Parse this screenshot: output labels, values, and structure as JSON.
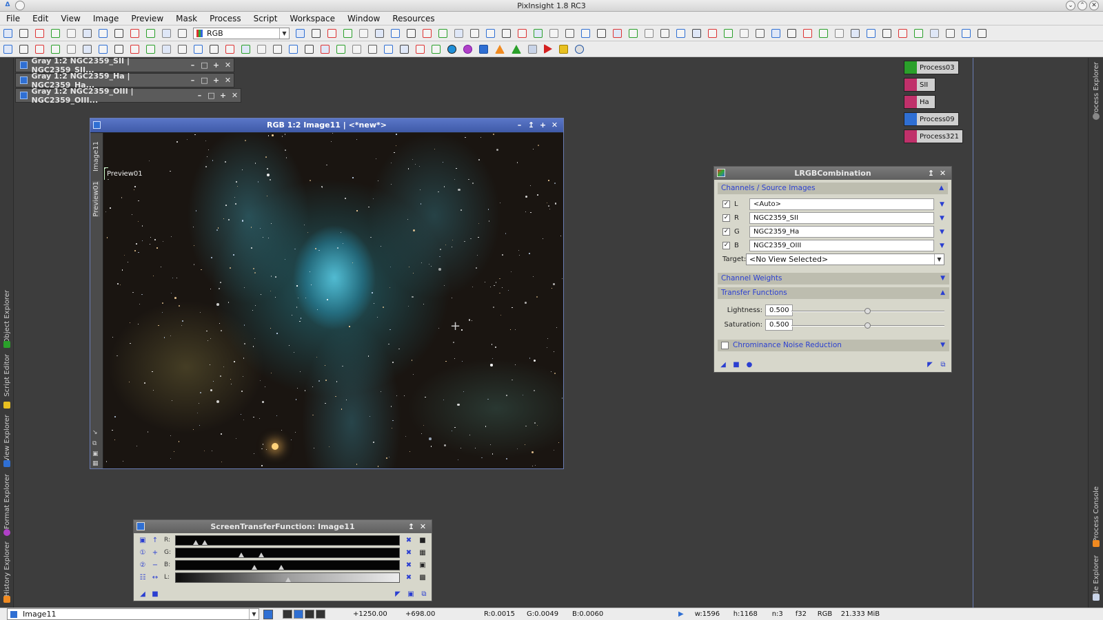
{
  "window": {
    "title": "PixInsight 1.8 RC3"
  },
  "menu": [
    "File",
    "Edit",
    "View",
    "Image",
    "Preview",
    "Mask",
    "Process",
    "Script",
    "Workspace",
    "Window",
    "Resources"
  ],
  "toolbar": {
    "channel_select": "RGB"
  },
  "left_dock_tabs": [
    {
      "label": "Object Explorer",
      "color": "#2aa02a"
    },
    {
      "label": "Script Editor",
      "color": "#e8c020"
    },
    {
      "label": "View Explorer",
      "color": "#2f6fd3"
    },
    {
      "label": "Format Explorer",
      "color": "#b040c8"
    },
    {
      "label": "History Explorer",
      "color": "#f08a20"
    }
  ],
  "right_dock_tabs": [
    {
      "label": "Process Explorer"
    },
    {
      "label": "Process Console"
    },
    {
      "label": "File Explorer"
    }
  ],
  "iconized_windows": [
    {
      "label": "Gray 1:2 NGC2359_SII | NGC2359_SII..."
    },
    {
      "label": "Gray 1:2 NGC2359_Ha | NGC2359_Ha..."
    },
    {
      "label": "Gray 1:2 NGC2359_OIII | NGC2359_OIII..."
    }
  ],
  "image_window": {
    "title": "RGB 1:2 Image11 | <*new*>",
    "side_tabs": [
      "Image11",
      "Preview01"
    ],
    "preview_label": "Preview01"
  },
  "process_icons": [
    {
      "label": "Process03",
      "color": "#2aa02a"
    },
    {
      "label": "SII",
      "color": "#c0306a"
    },
    {
      "label": "Ha",
      "color": "#c0306a"
    },
    {
      "label": "Process09",
      "color": "#2f6fd3"
    },
    {
      "label": "Process321",
      "color": "#c0306a"
    }
  ],
  "lrgb": {
    "title": "LRGBCombination",
    "section_channels": "Channels / Source Images",
    "channels": [
      {
        "letter": "L",
        "checked": true,
        "value": "<Auto>"
      },
      {
        "letter": "R",
        "checked": true,
        "value": "NGC2359_SII"
      },
      {
        "letter": "G",
        "checked": true,
        "value": "NGC2359_Ha"
      },
      {
        "letter": "B",
        "checked": true,
        "value": "NGC2359_OIII"
      }
    ],
    "target_label": "Target:",
    "target_value": "<No View Selected>",
    "section_weights": "Channel Weights",
    "section_transfer": "Transfer Functions",
    "lightness_label": "Lightness:",
    "lightness_value": "0.500",
    "saturation_label": "Saturation:",
    "saturation_value": "0.500",
    "lightness_fraction": 0.5,
    "saturation_fraction": 0.5,
    "section_noise": "Chrominance Noise Reduction",
    "noise_checked": false
  },
  "stf": {
    "title": "ScreenTransferFunction: Image11",
    "rows": [
      {
        "label": "R:",
        "marks": [
          0.09,
          0.13
        ]
      },
      {
        "label": "G:",
        "marks": [
          0.29,
          0.38
        ]
      },
      {
        "label": "B:",
        "marks": [
          0.35,
          0.47
        ]
      },
      {
        "label": "L:",
        "marks": [
          0.5
        ]
      }
    ]
  },
  "status": {
    "view_select": "Image11",
    "x": "+1250.00",
    "y": "+698.00",
    "r": "R:0.0015",
    "g": "G:0.0049",
    "b": "B:0.0060",
    "w": "w:1596",
    "h": "h:1168",
    "n": "n:3",
    "f": "f32",
    "mode": "RGB",
    "size": "21.333 MiB"
  },
  "colors": {
    "accent": "#2b3fd1",
    "image_window_title": "#4a66b8"
  }
}
